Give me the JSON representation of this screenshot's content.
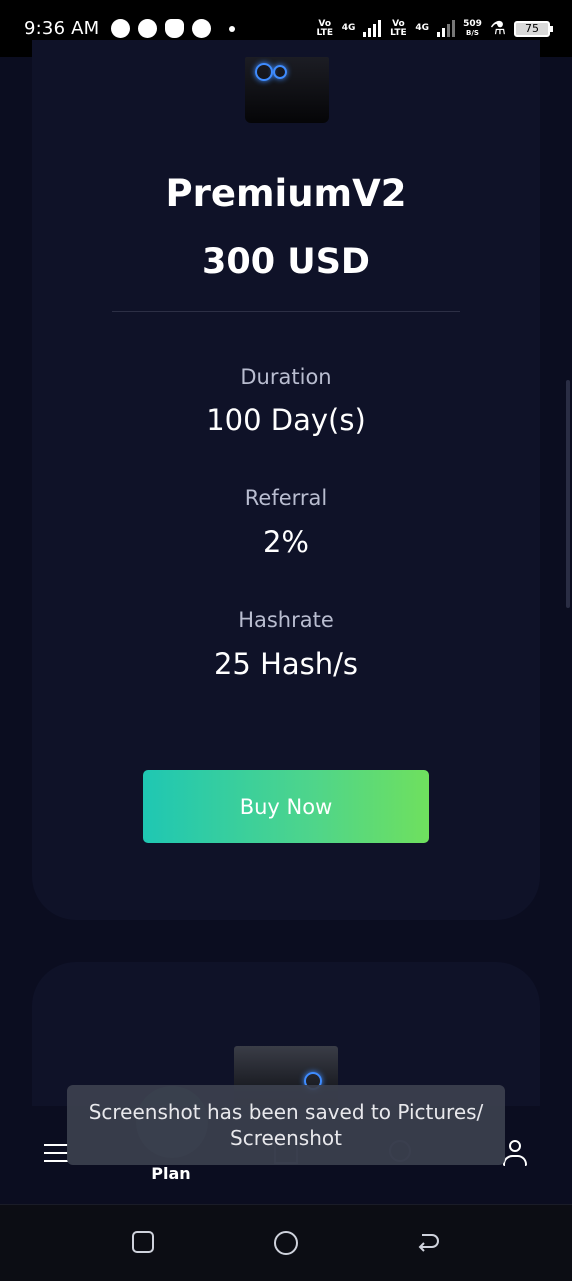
{
  "status_bar": {
    "time": "9:36 AM",
    "notifications": [
      "messenger-icon",
      "messenger-icon",
      "snapchat-icon",
      "chat-icon"
    ],
    "sim1": "Vo LTE",
    "sim1_net": "4G",
    "sim2": "Vo LTE",
    "sim2_net": "4G",
    "speed_value": "509",
    "speed_unit": "B/S",
    "battery": "75"
  },
  "plan": {
    "name": "PremiumV2",
    "price": "300 USD",
    "duration_label": "Duration",
    "duration_value": "100 Day(s)",
    "referral_label": "Referral",
    "referral_value": "2%",
    "hashrate_label": "Hashrate",
    "hashrate_value": "25 Hash/s",
    "buy_label": "Buy Now"
  },
  "bottom_nav": {
    "items": [
      {
        "icon": "menu-icon"
      },
      {
        "icon": "plan-icon",
        "label": "Plan",
        "active": true
      },
      {
        "icon": "home-icon"
      },
      {
        "icon": "support-icon"
      },
      {
        "icon": "profile-icon"
      }
    ]
  },
  "toast": {
    "line1": "Screenshot has been saved to  Pictures/",
    "line2": "Screenshot"
  },
  "colors": {
    "background": "#0b0d20",
    "card": "#0f1228",
    "button_start": "#1fc7b3",
    "button_end": "#6fe05e"
  }
}
